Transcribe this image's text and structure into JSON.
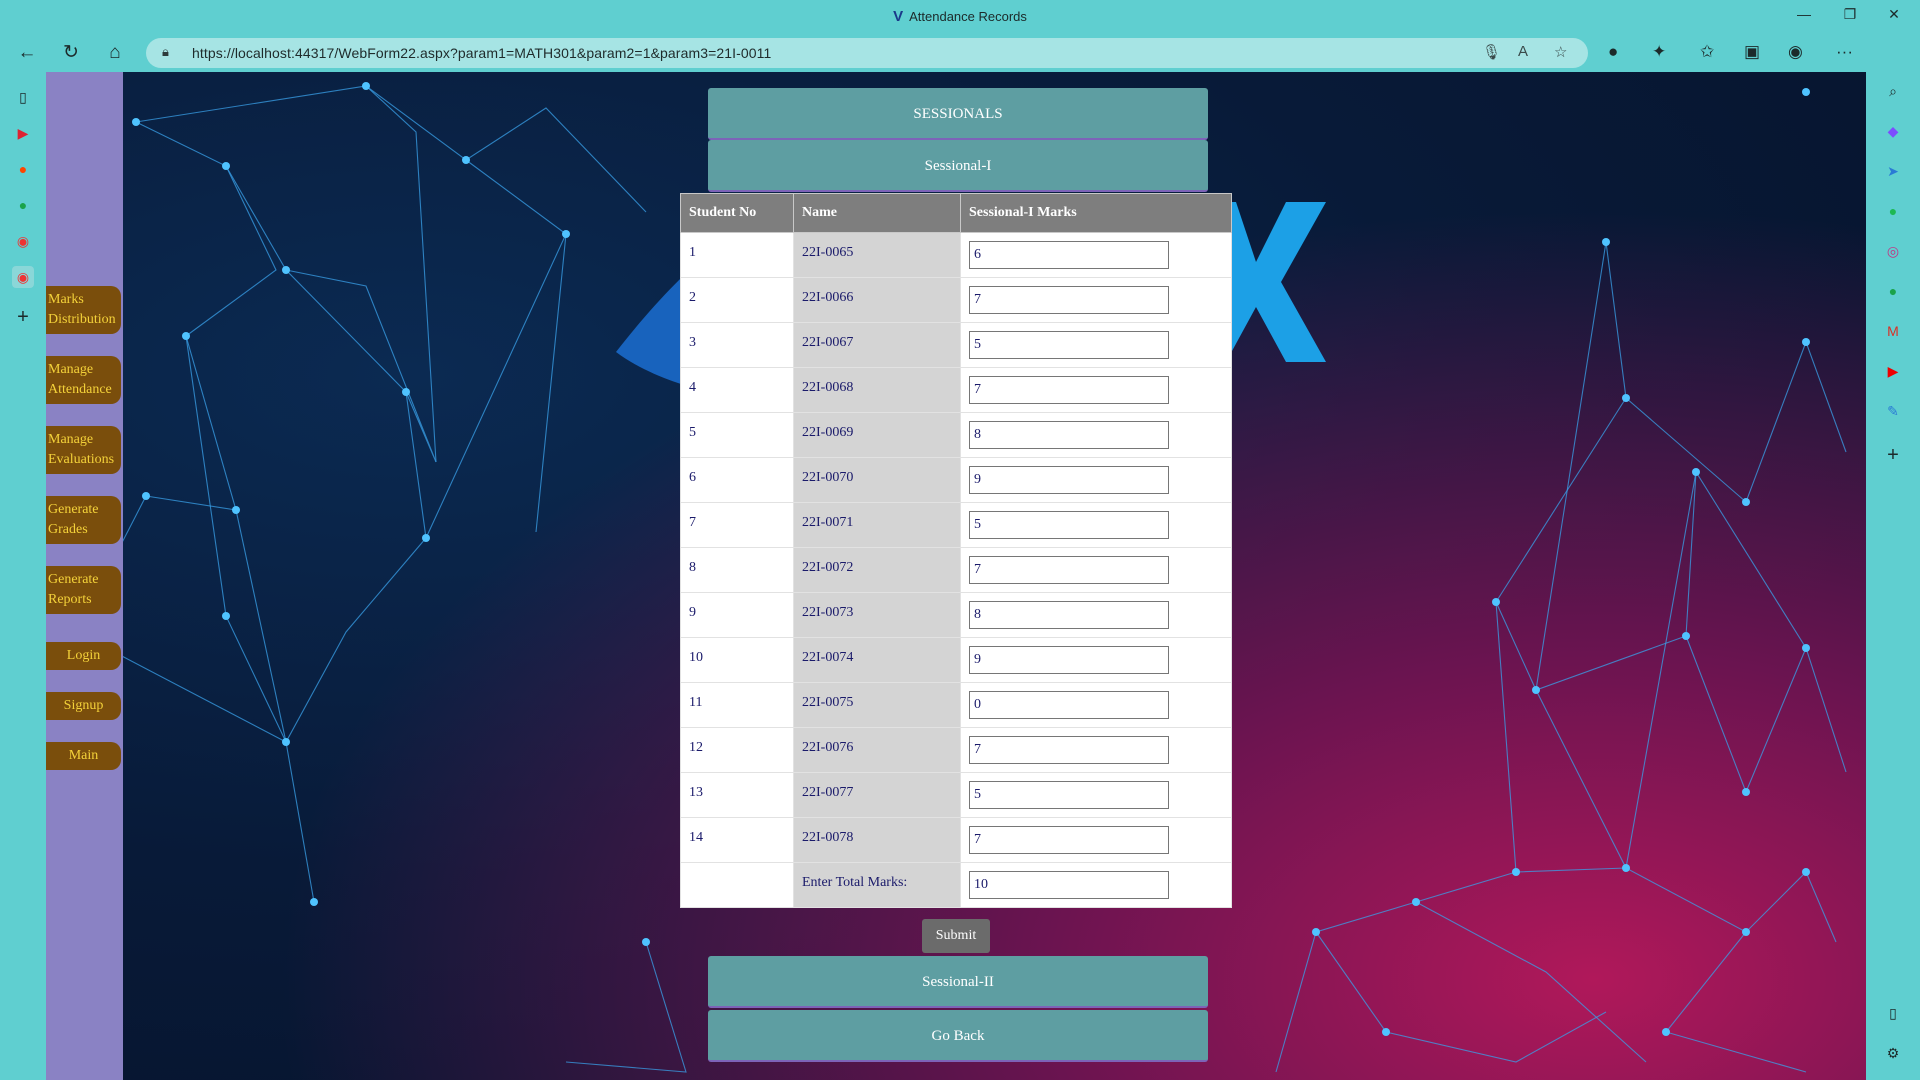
{
  "window": {
    "title": "Attendance Records",
    "controls": [
      "—",
      "❐",
      "✕"
    ]
  },
  "browser": {
    "url": "https://localhost:44317/WebForm22.aspx?param1=MATH301&param2=1&param3=21I-0011",
    "back_icon": "arrow-left-icon",
    "refresh_icon": "refresh-icon",
    "home_icon": "home-icon",
    "more_label": "···"
  },
  "sidebar": {
    "items": [
      {
        "label": "Marks Distribution"
      },
      {
        "label": "Manage Attendance"
      },
      {
        "label": "Manage Evaluations"
      },
      {
        "label": "Generate Grades"
      },
      {
        "label": "Generate Reports"
      },
      {
        "label": "Login"
      },
      {
        "label": "Signup"
      },
      {
        "label": "Main"
      }
    ]
  },
  "page": {
    "header_button": "SESSIONALS",
    "section_button": "Sessional-I",
    "table_headers": [
      "Student No",
      "Name",
      "Sessional-I Marks"
    ],
    "rows": [
      {
        "no": "1",
        "name": "22I-0065",
        "marks": "6"
      },
      {
        "no": "2",
        "name": "22I-0066",
        "marks": "7"
      },
      {
        "no": "3",
        "name": "22I-0067",
        "marks": "5"
      },
      {
        "no": "4",
        "name": "22I-0068",
        "marks": "7"
      },
      {
        "no": "5",
        "name": "22I-0069",
        "marks": "8"
      },
      {
        "no": "6",
        "name": "22I-0070",
        "marks": "9"
      },
      {
        "no": "7",
        "name": "22I-0071",
        "marks": "5"
      },
      {
        "no": "8",
        "name": "22I-0072",
        "marks": "7"
      },
      {
        "no": "9",
        "name": "22I-0073",
        "marks": "8"
      },
      {
        "no": "10",
        "name": "22I-0074",
        "marks": "9"
      },
      {
        "no": "11",
        "name": "22I-0075",
        "marks": "0"
      },
      {
        "no": "12",
        "name": "22I-0076",
        "marks": "7"
      },
      {
        "no": "13",
        "name": "22I-0077",
        "marks": "5"
      },
      {
        "no": "14",
        "name": "22I-0078",
        "marks": "7"
      }
    ],
    "total_label": "Enter Total Marks:",
    "total_value": "10",
    "submit_label": "Submit",
    "sessional2_button": "Sessional-II",
    "go_back_button": "Go Back"
  },
  "colors": {
    "sidebar_button_bg": "#7a4e0c",
    "sidebar_button_text": "#f4d23a",
    "section_button_bg": "#5e9ea2",
    "sidebar_strip": "#8a82c4",
    "browser_chrome": "#5fcfd0"
  }
}
